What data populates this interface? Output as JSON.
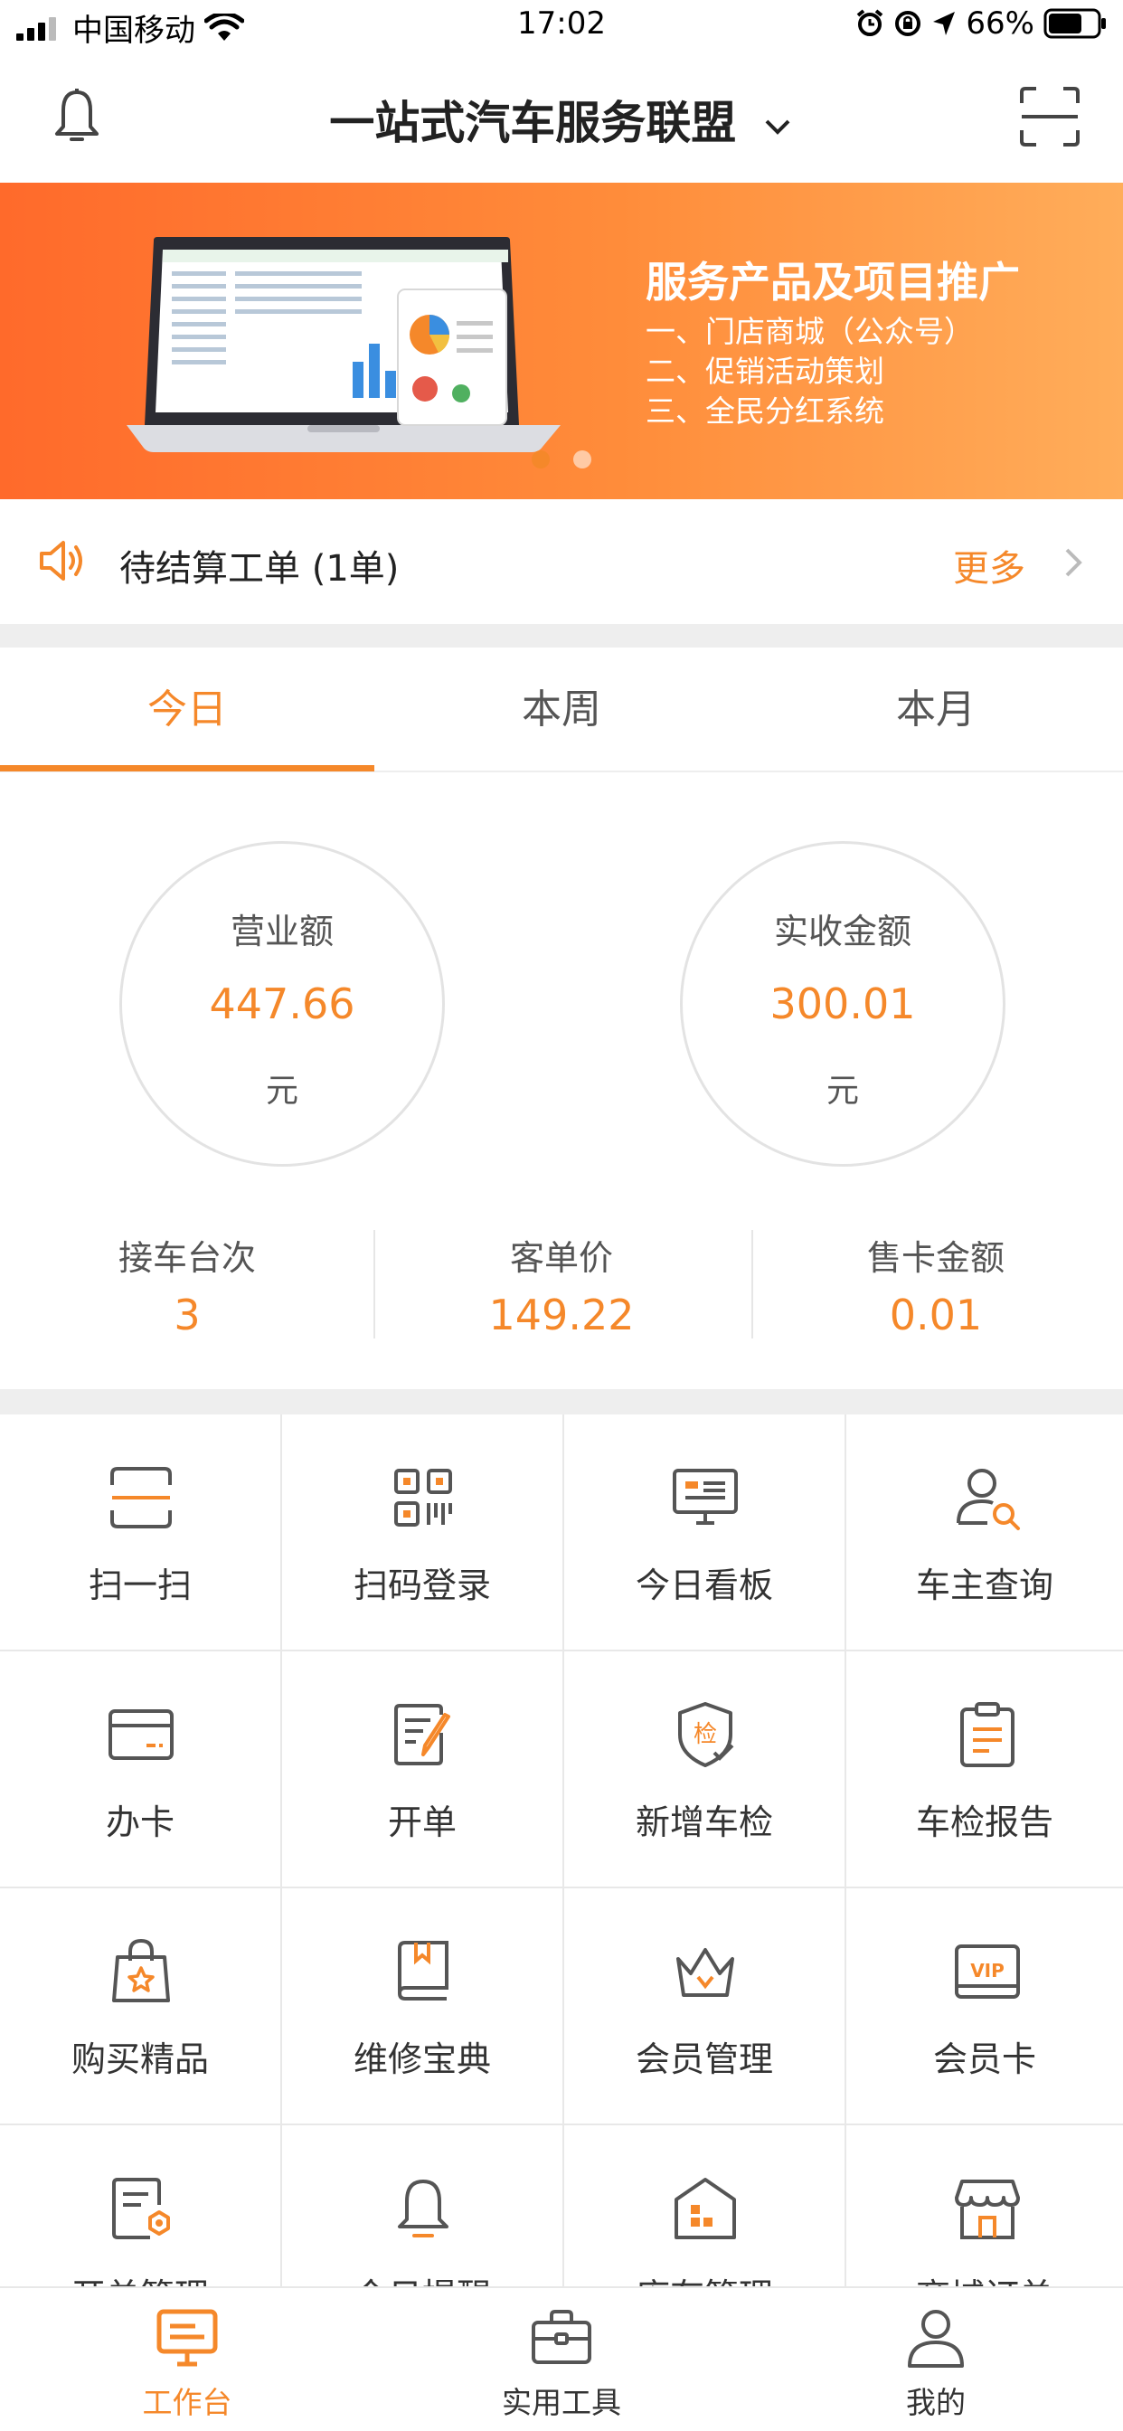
{
  "status_bar": {
    "carrier": "中国移动",
    "time": "17:02",
    "battery": "66%"
  },
  "nav": {
    "title": "一站式汽车服务联盟"
  },
  "banner": {
    "title": "服务产品及项目推广",
    "lines": [
      "一、门店商城（公众号）",
      "二、促销活动策划",
      "三、全民分红系统"
    ],
    "page_count": 2,
    "active_page": 0
  },
  "notice": {
    "text": "待结算工单 (1单)",
    "more": "更多"
  },
  "tabs": [
    "今日",
    "本周",
    "本月"
  ],
  "stats": {
    "revenue": {
      "label": "营业额",
      "value": "447.66",
      "unit": "元"
    },
    "received": {
      "label": "实收金额",
      "value": "300.01",
      "unit": "元"
    },
    "cars": {
      "label": "接车台次",
      "value": "3"
    },
    "avg_price": {
      "label": "客单价",
      "value": "149.22"
    },
    "card_sales": {
      "label": "售卡金额",
      "value": "0.01"
    }
  },
  "grid": [
    {
      "label": "扫一扫",
      "icon": "scan-icon"
    },
    {
      "label": "扫码登录",
      "icon": "qr-code-icon"
    },
    {
      "label": "今日看板",
      "icon": "dashboard-monitor-icon"
    },
    {
      "label": "车主查询",
      "icon": "user-search-icon"
    },
    {
      "label": "办卡",
      "icon": "card-icon"
    },
    {
      "label": "开单",
      "icon": "document-edit-icon"
    },
    {
      "label": "新增车检",
      "icon": "shield-check-icon"
    },
    {
      "label": "车检报告",
      "icon": "clipboard-icon"
    },
    {
      "label": "购买精品",
      "icon": "shopping-bag-icon"
    },
    {
      "label": "维修宝典",
      "icon": "book-icon"
    },
    {
      "label": "会员管理",
      "icon": "crown-icon"
    },
    {
      "label": "会员卡",
      "icon": "vip-card-icon"
    },
    {
      "label": "开单管理",
      "icon": "document-settings-icon"
    },
    {
      "label": "今日提醒",
      "icon": "bell-icon"
    },
    {
      "label": "库存管理",
      "icon": "warehouse-icon"
    },
    {
      "label": "商城订单",
      "icon": "store-icon"
    }
  ],
  "tabbar": [
    {
      "label": "工作台",
      "icon": "workbench-icon"
    },
    {
      "label": "实用工具",
      "icon": "toolbox-icon"
    },
    {
      "label": "我的",
      "icon": "person-icon"
    }
  ],
  "banner_labels": {
    "vip": "VIP",
    "check": "检"
  },
  "colors": {
    "accent": "#f5882a",
    "banner_start": "#ff6a2b",
    "banner_end": "#ffad5a",
    "divider": "#eeeeee",
    "icon_gray": "#555555"
  }
}
